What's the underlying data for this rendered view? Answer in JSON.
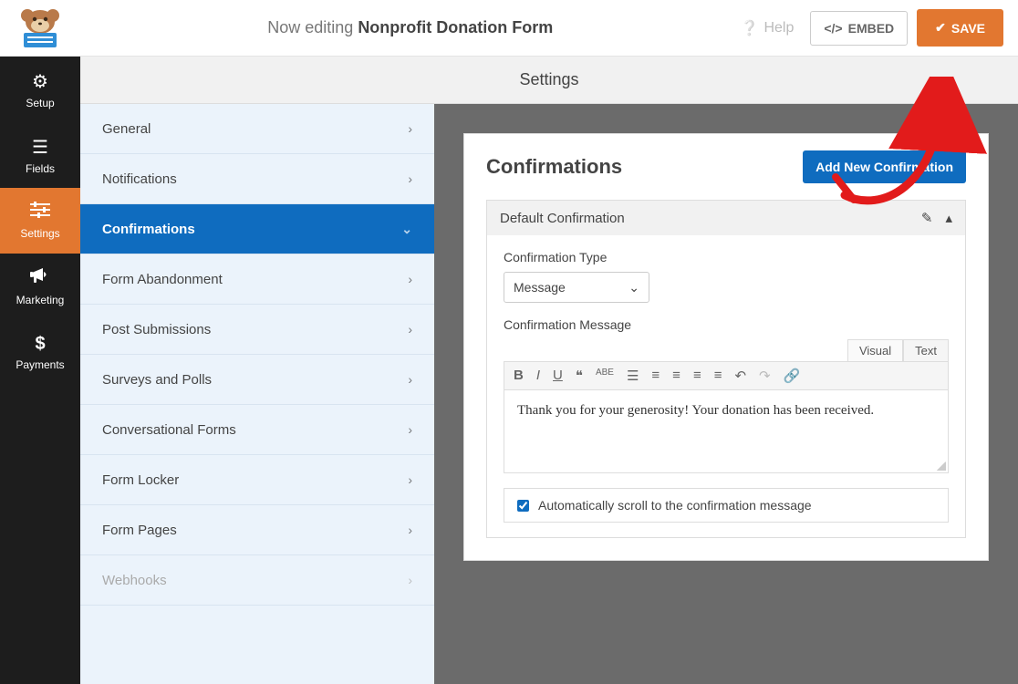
{
  "header": {
    "prefix": "Now editing",
    "form_name": "Nonprofit Donation Form",
    "help": "Help",
    "embed": "EMBED",
    "save": "SAVE"
  },
  "leftnav": {
    "items": [
      {
        "label": "Setup"
      },
      {
        "label": "Fields"
      },
      {
        "label": "Settings"
      },
      {
        "label": "Marketing"
      },
      {
        "label": "Payments"
      }
    ]
  },
  "section_title": "Settings",
  "settings_menu": {
    "items": [
      {
        "label": "General"
      },
      {
        "label": "Notifications"
      },
      {
        "label": "Confirmations"
      },
      {
        "label": "Form Abandonment"
      },
      {
        "label": "Post Submissions"
      },
      {
        "label": "Surveys and Polls"
      },
      {
        "label": "Conversational Forms"
      },
      {
        "label": "Form Locker"
      },
      {
        "label": "Form Pages"
      },
      {
        "label": "Webhooks"
      }
    ]
  },
  "confirmations": {
    "heading": "Confirmations",
    "add_button": "Add New Confirmation",
    "block_title": "Default Confirmation",
    "type_label": "Confirmation Type",
    "type_value": "Message",
    "message_label": "Confirmation Message",
    "tabs": {
      "visual": "Visual",
      "text": "Text"
    },
    "message_body": "Thank you for your generosity! Your donation has been received.",
    "auto_scroll_label": "Automatically scroll to the confirmation message",
    "auto_scroll_checked": true
  },
  "colors": {
    "accent": "#e27730",
    "primary_blue": "#0f6cbf"
  }
}
